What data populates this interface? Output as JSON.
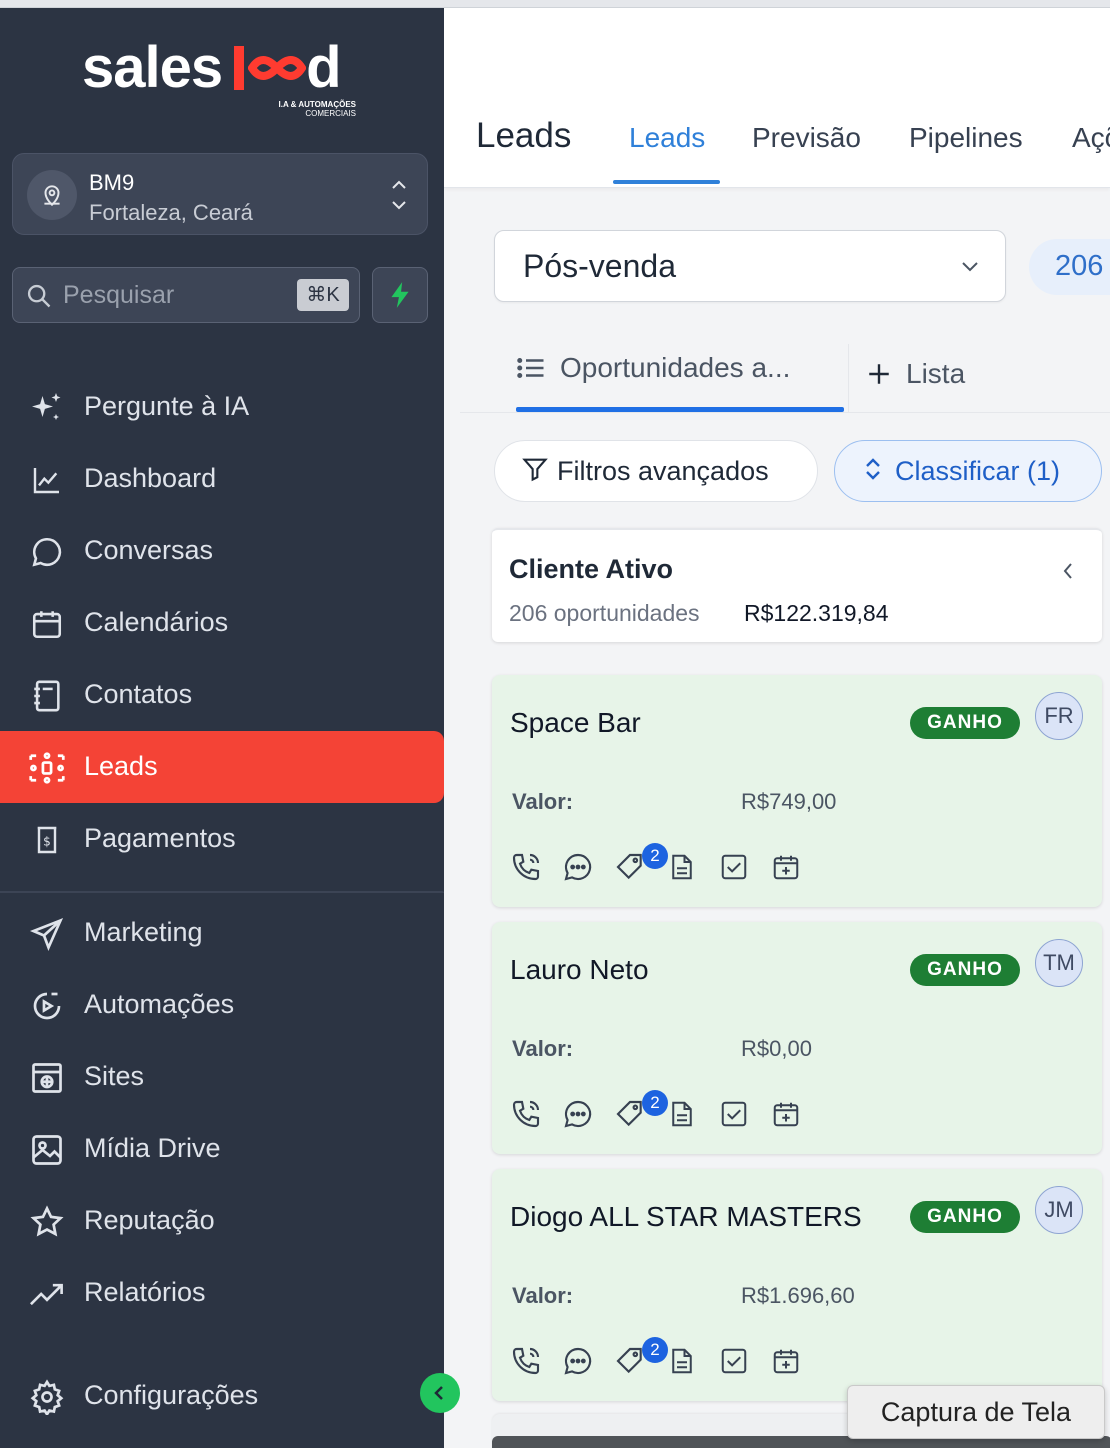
{
  "brand": {
    "logo_text": "saleslead",
    "tagline_1": "I.A & AUTOMAÇÕES",
    "tagline_2": "COMERCIAIS"
  },
  "location": {
    "name": "BM9",
    "city": "Fortaleza, Ceará"
  },
  "search": {
    "placeholder": "Pesquisar",
    "shortcut": "⌘K"
  },
  "nav": {
    "primary": [
      {
        "label": "Pergunte à IA",
        "icon": "sparkles-icon"
      },
      {
        "label": "Dashboard",
        "icon": "chart-line-icon"
      },
      {
        "label": "Conversas",
        "icon": "chat-bubble-icon"
      },
      {
        "label": "Calendários",
        "icon": "calendar-icon"
      },
      {
        "label": "Contatos",
        "icon": "contacts-book-icon"
      },
      {
        "label": "Leads",
        "icon": "leads-network-icon",
        "active": true
      },
      {
        "label": "Pagamentos",
        "icon": "receipt-dollar-icon"
      }
    ],
    "secondary": [
      {
        "label": "Marketing",
        "icon": "paper-plane-icon"
      },
      {
        "label": "Automações",
        "icon": "play-circle-icon"
      },
      {
        "label": "Sites",
        "icon": "globe-window-icon"
      },
      {
        "label": "Mídia Drive",
        "icon": "image-icon"
      },
      {
        "label": "Reputação",
        "icon": "star-icon"
      },
      {
        "label": "Relatórios",
        "icon": "trend-up-icon"
      },
      {
        "label": "Configurações",
        "icon": "gear-icon"
      }
    ]
  },
  "header": {
    "title": "Leads",
    "tabs": [
      {
        "label": "Leads",
        "active": true
      },
      {
        "label": "Previsão"
      },
      {
        "label": "Pipelines"
      },
      {
        "label": "Açõ"
      }
    ]
  },
  "pipeline": {
    "selected": "Pós-venda",
    "count": "206"
  },
  "views": {
    "active_label": "Oportunidades a...",
    "add_label": "Lista"
  },
  "toolbar": {
    "filter_label": "Filtros avançados",
    "sort_label": "Classificar (1)"
  },
  "colors": {
    "accent": "#2f80d9",
    "sidebar_bg": "#2c3443",
    "active_nav": "#f44336",
    "won_badge": "#1e7e34",
    "card_bg": "#e7f4e8"
  },
  "stage": {
    "title": "Cliente Ativo",
    "count_text": "206 oportunidades",
    "total": "R$122.319,84"
  },
  "cards": [
    {
      "name": "Space Bar",
      "status": "GANHO",
      "owner": "FR",
      "valor_label": "Valor:",
      "valor": "R$749,00",
      "tags_count": "2"
    },
    {
      "name": "Lauro Neto",
      "status": "GANHO",
      "owner": "TM",
      "valor_label": "Valor:",
      "valor": "R$0,00",
      "tags_count": "2"
    },
    {
      "name": "Diogo ALL STAR MASTERS",
      "status": "GANHO",
      "owner": "JM",
      "valor_label": "Valor:",
      "valor": "R$1.696,60",
      "tags_count": "2"
    }
  ],
  "tooltip": "Captura de Tela"
}
